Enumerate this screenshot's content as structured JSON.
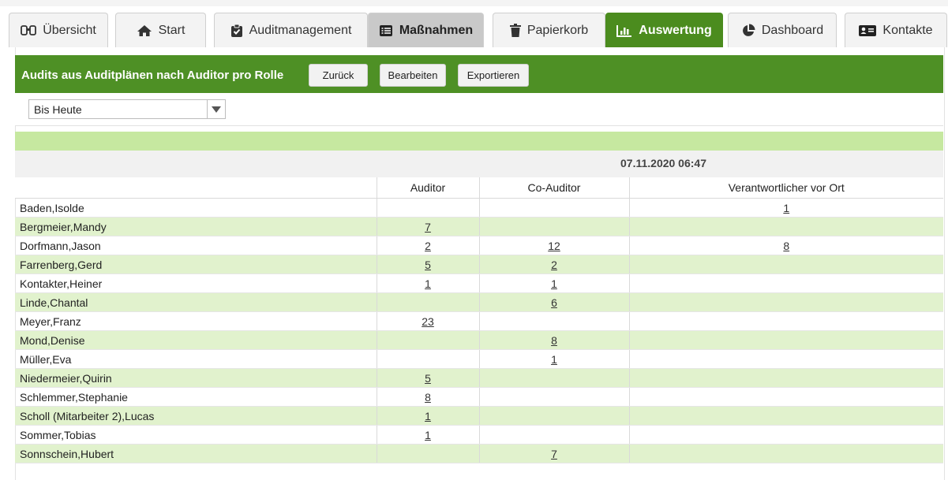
{
  "tabs": [
    {
      "label": "Übersicht",
      "icon": "binoculars-icon",
      "state": "normal"
    },
    {
      "label": "Start",
      "icon": "home-icon",
      "state": "normal"
    },
    {
      "label": "Auditmanagement",
      "icon": "clipboard-check-icon",
      "state": "normal"
    },
    {
      "label": "Maßnahmen",
      "icon": "list-icon",
      "state": "selected-grey"
    },
    {
      "label": "Papierkorb",
      "icon": "trash-icon",
      "state": "normal"
    },
    {
      "label": "Auswertung",
      "icon": "bar-chart-icon",
      "state": "active"
    },
    {
      "label": "Dashboard",
      "icon": "pie-chart-icon",
      "state": "normal"
    },
    {
      "label": "Kontakte",
      "icon": "contact-card-icon",
      "state": "normal"
    }
  ],
  "header": {
    "title": "Audits aus Auditplänen nach Auditor pro Rolle",
    "back_label": "Zurück",
    "edit_label": "Bearbeiten",
    "export_label": "Exportieren"
  },
  "filter": {
    "selected": "Bis Heute"
  },
  "report": {
    "timestamp": "07.11.2020 06:47",
    "columns": [
      "Auditor",
      "Co-Auditor",
      "Verantwortlicher vor Ort"
    ],
    "rows": [
      {
        "name": "Baden,Isolde",
        "auditor": "",
        "co_auditor": "",
        "verantwortlicher": "1"
      },
      {
        "name": "Bergmeier,Mandy",
        "auditor": "7",
        "co_auditor": "",
        "verantwortlicher": ""
      },
      {
        "name": "Dorfmann,Jason",
        "auditor": "2",
        "co_auditor": "12",
        "verantwortlicher": "8"
      },
      {
        "name": "Farrenberg,Gerd",
        "auditor": "5",
        "co_auditor": "2",
        "verantwortlicher": ""
      },
      {
        "name": "Kontakter,Heiner",
        "auditor": "1",
        "co_auditor": "1",
        "verantwortlicher": ""
      },
      {
        "name": "Linde,Chantal",
        "auditor": "",
        "co_auditor": "6",
        "verantwortlicher": ""
      },
      {
        "name": "Meyer,Franz",
        "auditor": "23",
        "co_auditor": "",
        "verantwortlicher": ""
      },
      {
        "name": "Mond,Denise",
        "auditor": "",
        "co_auditor": "8",
        "verantwortlicher": ""
      },
      {
        "name": "Müller,Eva",
        "auditor": "",
        "co_auditor": "1",
        "verantwortlicher": ""
      },
      {
        "name": "Niedermeier,Quirin",
        "auditor": "5",
        "co_auditor": "",
        "verantwortlicher": ""
      },
      {
        "name": "Schlemmer,Stephanie",
        "auditor": "8",
        "co_auditor": "",
        "verantwortlicher": ""
      },
      {
        "name": "Scholl (Mitarbeiter 2),Lucas",
        "auditor": "1",
        "co_auditor": "",
        "verantwortlicher": ""
      },
      {
        "name": "Sommer,Tobias",
        "auditor": "1",
        "co_auditor": "",
        "verantwortlicher": ""
      },
      {
        "name": "Sonnschein,Hubert",
        "auditor": "",
        "co_auditor": "7",
        "verantwortlicher": ""
      }
    ]
  },
  "colors": {
    "active_tab": "#4b8c1e",
    "header_bar": "#4e9025",
    "highlight_band": "#c6e8a0",
    "alt_row": "#e1f2cd"
  }
}
